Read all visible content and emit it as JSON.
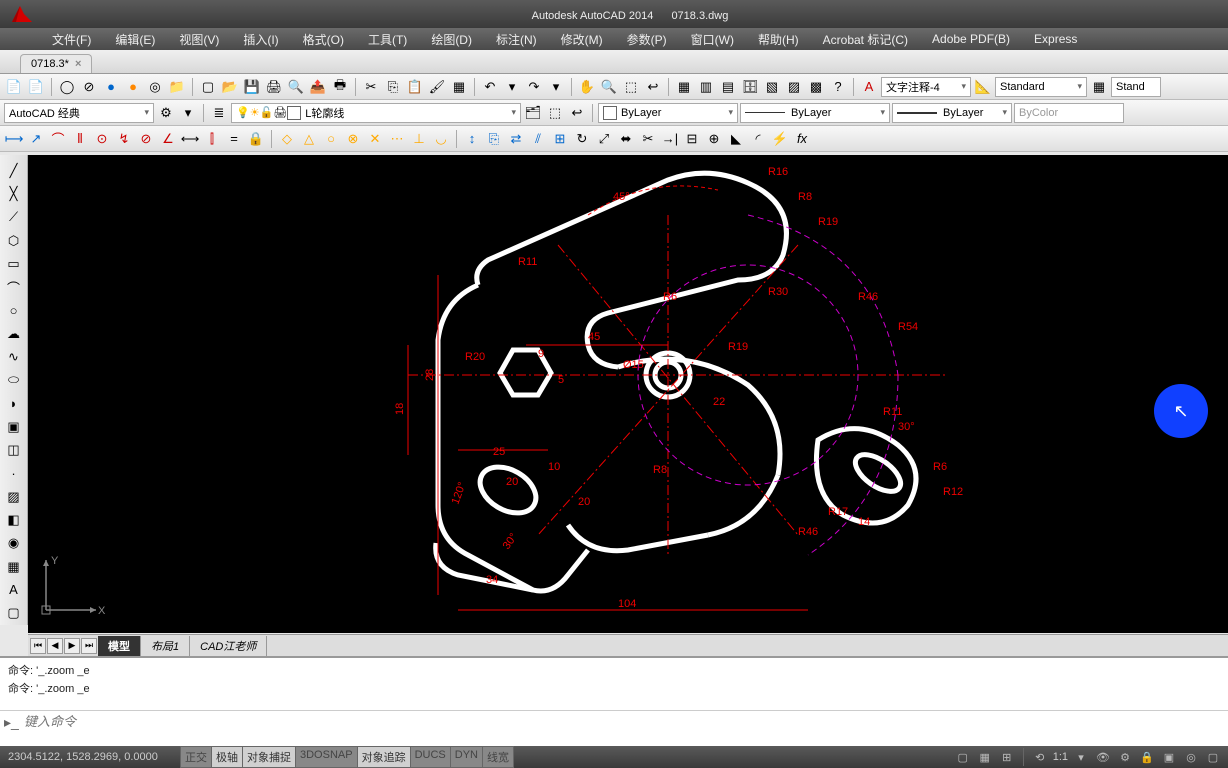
{
  "title": {
    "app": "Autodesk AutoCAD 2014",
    "file": "0718.3.dwg"
  },
  "menu": [
    "文件(F)",
    "编辑(E)",
    "视图(V)",
    "插入(I)",
    "格式(O)",
    "工具(T)",
    "绘图(D)",
    "标注(N)",
    "修改(M)",
    "参数(P)",
    "窗口(W)",
    "帮助(H)",
    "Acrobat 标记(C)",
    "Adobe PDF(B)",
    "Express"
  ],
  "file_tab": {
    "label": "0718.3*"
  },
  "workspace": {
    "name": "AutoCAD 经典"
  },
  "layer": {
    "current": "L轮廓线"
  },
  "text_style": "文字注释-4",
  "dim_style": "Standard",
  "table_style": "Stand",
  "props": {
    "color": "ByLayer",
    "linetype": "ByLayer",
    "lineweight": "ByLayer",
    "plotstyle": "ByColor"
  },
  "layout_tabs": [
    "模型",
    "布局1",
    "CAD江老师"
  ],
  "cmd_history": [
    "命令:  '_.zoom _e",
    "命令:  '_.zoom _e"
  ],
  "cmd_placeholder": "键入命令",
  "status": {
    "coords": "2304.5122, 1528.2969, 0.0000",
    "toggles": [
      "正交",
      "极轴",
      "对象捕捉",
      "3DOSNAP",
      "对象追踪",
      "DUCS",
      "DYN",
      "线宽"
    ],
    "scale": "1:1"
  },
  "dim_labels": [
    "R16",
    "R8",
    "R19",
    "R46",
    "R54",
    "R30",
    "R19",
    "R11",
    "R6",
    "R12",
    "R17",
    "14",
    "R46",
    "R8",
    "22",
    "30°",
    "Ø15",
    "45",
    "5",
    "9",
    "28",
    "18",
    "R20",
    "R11",
    "45°",
    "25",
    "20",
    "10",
    "34",
    "30°",
    "120°",
    "104",
    "20",
    "R6"
  ]
}
